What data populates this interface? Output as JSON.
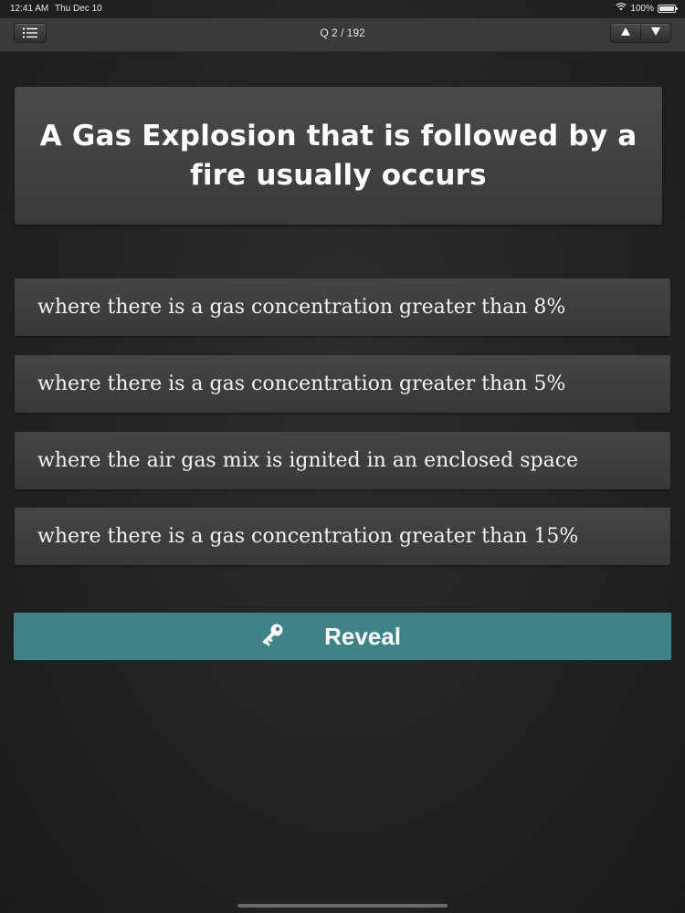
{
  "status_bar": {
    "time": "12:41 AM",
    "date": "Thu Dec 10",
    "battery": "100%"
  },
  "nav": {
    "title": "Q 2 / 192",
    "menu_icon": "list-icon",
    "up_icon": "arrow-up-icon",
    "down_icon": "arrow-down-icon"
  },
  "question": {
    "text": "A Gas Explosion that is followed by a fire usually occurs"
  },
  "answers": [
    {
      "text": "where there is a gas concentration greater than 8%"
    },
    {
      "text": "where there is a gas concentration greater than 5%"
    },
    {
      "text": "where the air gas mix is ignited in an enclosed space"
    },
    {
      "text": "where there is a gas concentration greater than 15%"
    }
  ],
  "reveal": {
    "label": "Reveal",
    "icon": "key-icon"
  },
  "colors": {
    "accent": "#3f8389",
    "background": "#222222",
    "card": "#404040"
  }
}
